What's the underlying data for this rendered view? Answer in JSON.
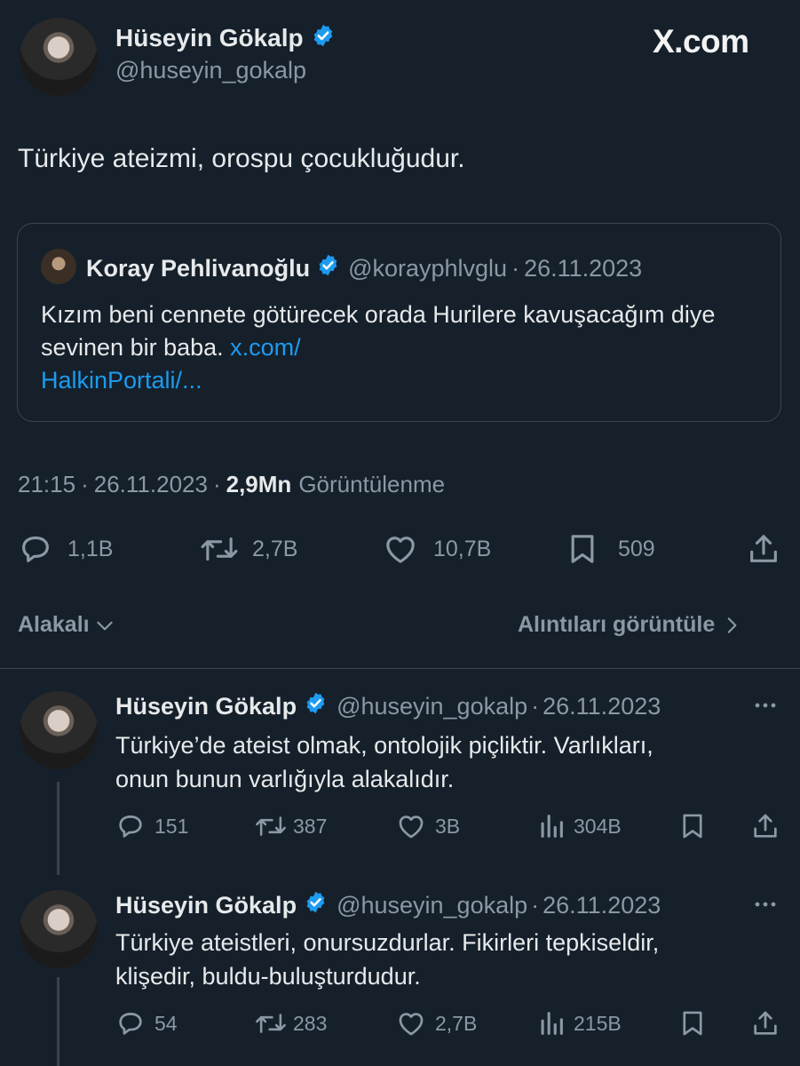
{
  "main_tweet": {
    "author_name": "Hüseyin Gökalp",
    "author_handle": "@huseyin_gokalp",
    "watermark": "X.com",
    "text": "Türkiye ateizmi, orospu çocukluğudur.",
    "quoted": {
      "author_name": "Koray Pehlivanoğlu",
      "author_handle": "@korayphlvglu",
      "date": "26.11.2023",
      "text": "Kızım beni cennete götürecek orada Hurilere kavuşacağım diye sevinen bir baba.",
      "link_line1": "x.com/",
      "link_line2": "HalkinPortali/..."
    },
    "time": "21:15",
    "date": "26.11.2023",
    "views": "2,9Mn",
    "views_label": "Görüntülenme",
    "stats": {
      "replies": "1,1B",
      "retweets": "2,7B",
      "likes": "10,7B",
      "bookmarks": "509"
    }
  },
  "filter_bar": {
    "sort_label": "Alakalı",
    "quotes_label": "Alıntıları görüntüle"
  },
  "replies": [
    {
      "author_name": "Hüseyin Gökalp",
      "author_handle": "@huseyin_gokalp",
      "date": "26.11.2023",
      "text_line1": "Türkiye’de ateist olmak, ontolojik piçliktir. Varlıkları,",
      "text_line2": "onun bunun varlığıyla alakalıdır.",
      "replies": "151",
      "retweets": "387",
      "likes": "3B",
      "views": "304B"
    },
    {
      "author_name": "Hüseyin Gökalp",
      "author_handle": "@huseyin_gokalp",
      "date": "26.11.2023",
      "text_line1": "Türkiye ateistleri, onursuzdurlar. Fikirleri tepkiseldir,",
      "text_line2": "klişedir, buldu-buluşturdudur.",
      "replies": "54",
      "retweets": "283",
      "likes": "2,7B",
      "views": "215B"
    }
  ],
  "colors": {
    "background": "#15202b",
    "text": "#e7e9ea",
    "muted": "#8b98a5",
    "accent": "#1d9bf0",
    "border": "#38444d"
  }
}
